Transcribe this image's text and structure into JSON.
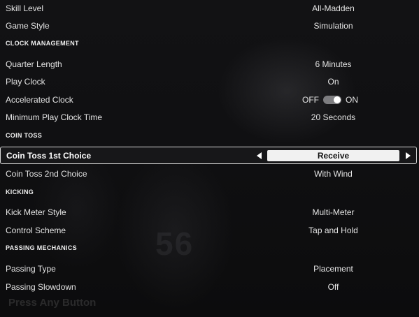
{
  "rows": {
    "skill_level": {
      "label": "Skill Level",
      "value": "All-Madden"
    },
    "game_style": {
      "label": "Game Style",
      "value": "Simulation"
    },
    "quarter_length": {
      "label": "Quarter Length",
      "value": "6 Minutes"
    },
    "play_clock": {
      "label": "Play Clock",
      "value": "On"
    },
    "accelerated_clock": {
      "label": "Accelerated Clock",
      "off_label": "OFF",
      "on_label": "ON",
      "state": "on"
    },
    "min_play_clock": {
      "label": "Minimum Play Clock Time",
      "value": "20 Seconds"
    },
    "coin_toss_1": {
      "label": "Coin Toss 1st Choice",
      "value": "Receive"
    },
    "coin_toss_2": {
      "label": "Coin Toss 2nd Choice",
      "value": "With Wind"
    },
    "kick_meter": {
      "label": "Kick Meter Style",
      "value": "Multi-Meter"
    },
    "control_scheme": {
      "label": "Control Scheme",
      "value": "Tap and Hold"
    },
    "passing_type": {
      "label": "Passing Type",
      "value": "Placement"
    },
    "passing_slowdown": {
      "label": "Passing Slowdown",
      "value": "Off"
    }
  },
  "sections": {
    "clock": "CLOCK MANAGEMENT",
    "coin_toss": "COIN TOSS",
    "kicking": "KICKING",
    "passing": "PASSING MECHANICS"
  },
  "background": {
    "jersey_number": "56"
  },
  "prompt": "Press Any Button",
  "colors": {
    "accent": "#f1f1f1",
    "background": "#0b0b0c",
    "toggle_track": "#7d7d80"
  }
}
